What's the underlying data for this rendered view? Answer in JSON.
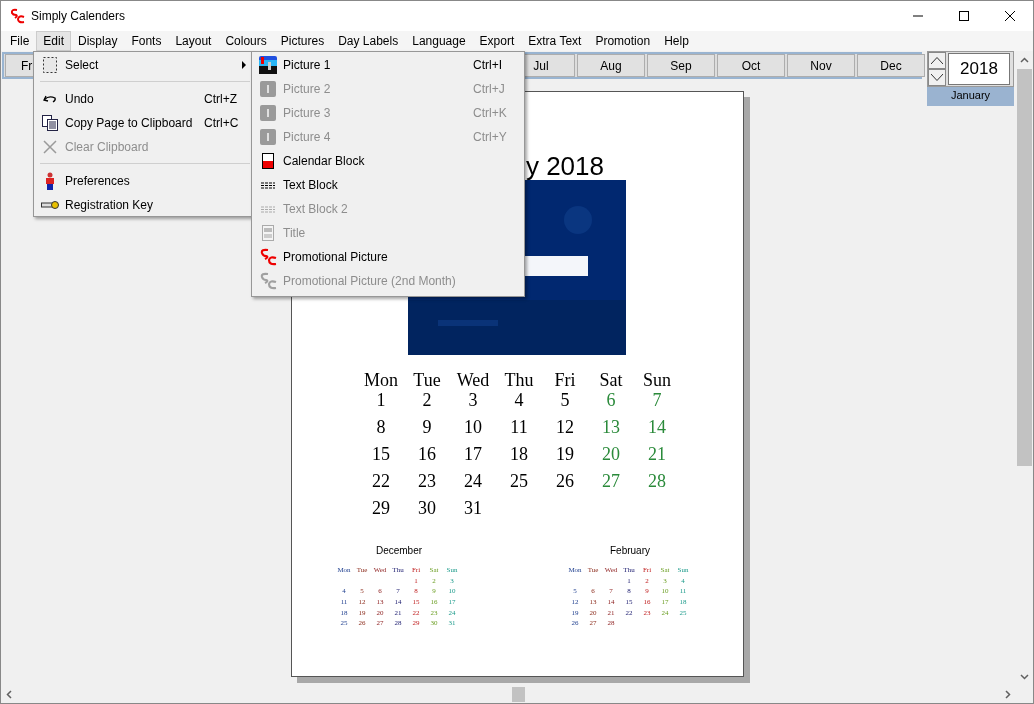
{
  "window": {
    "title": "Simply Calenders"
  },
  "menu_bar": [
    {
      "label": "File",
      "selected": false
    },
    {
      "label": "Edit",
      "selected": true
    },
    {
      "label": "Display",
      "selected": false
    },
    {
      "label": "Fonts",
      "selected": false
    },
    {
      "label": "Layout",
      "selected": false
    },
    {
      "label": "Colours",
      "selected": false
    },
    {
      "label": "Pictures",
      "selected": false
    },
    {
      "label": "Day Labels",
      "selected": false
    },
    {
      "label": "Language",
      "selected": false
    },
    {
      "label": "Export",
      "selected": false
    },
    {
      "label": "Extra Text",
      "selected": false
    },
    {
      "label": "Promotion",
      "selected": false
    },
    {
      "label": "Help",
      "selected": false
    }
  ],
  "month_buttons": [
    {
      "label": "Fr"
    },
    {
      "label": "Jul"
    },
    {
      "label": "Aug"
    },
    {
      "label": "Sep"
    },
    {
      "label": "Oct"
    },
    {
      "label": "Nov"
    },
    {
      "label": "Dec"
    }
  ],
  "year_spinner": {
    "value": "2018"
  },
  "month_label": "January",
  "edit_menu": [
    {
      "kind": "item",
      "label": "Select",
      "has_submenu": true,
      "disabled": false
    },
    {
      "kind": "separator"
    },
    {
      "kind": "item",
      "label": "Undo",
      "shortcut": "Ctrl+Z",
      "disabled": false
    },
    {
      "kind": "item",
      "label": "Copy Page to Clipboard",
      "shortcut": "Ctrl+C",
      "disabled": false
    },
    {
      "kind": "item",
      "label": "Clear Clipboard",
      "disabled": true
    },
    {
      "kind": "separator"
    },
    {
      "kind": "item",
      "label": "Preferences",
      "disabled": false
    },
    {
      "kind": "item",
      "label": "Registration Key",
      "disabled": false
    }
  ],
  "select_submenu": [
    {
      "label": "Picture 1",
      "shortcut": "Ctrl+I",
      "disabled": false
    },
    {
      "label": "Picture 2",
      "shortcut": "Ctrl+J",
      "disabled": true
    },
    {
      "label": "Picture 3",
      "shortcut": "Ctrl+K",
      "disabled": true
    },
    {
      "label": "Picture 4",
      "shortcut": "Ctrl+Y",
      "disabled": true
    },
    {
      "label": "Calendar Block",
      "disabled": false
    },
    {
      "label": "Text Block",
      "disabled": false
    },
    {
      "label": "Text Block 2",
      "disabled": true
    },
    {
      "label": "Title",
      "disabled": true
    },
    {
      "label": "Promotional Picture",
      "disabled": false
    },
    {
      "label": "Promotional Picture (2nd Month)",
      "disabled": true
    }
  ],
  "page": {
    "title": "y 2018",
    "calendar": {
      "weekdays": [
        {
          "label": "Mon",
          "weekend": false
        },
        {
          "label": "Tue",
          "weekend": false
        },
        {
          "label": "Wed",
          "weekend": false
        },
        {
          "label": "Thu",
          "weekend": false
        },
        {
          "label": "Fri",
          "weekend": false
        },
        {
          "label": "Sat",
          "weekend": true
        },
        {
          "label": "Sun",
          "weekend": true
        }
      ],
      "weeks": [
        {
          "mon": "1",
          "tue": "2",
          "wed": "3",
          "thu": "4",
          "fri": "5",
          "sat": "6",
          "sun": "7"
        },
        {
          "mon": "8",
          "tue": "9",
          "wed": "10",
          "thu": "11",
          "fri": "12",
          "sat": "13",
          "sun": "14"
        },
        {
          "mon": "15",
          "tue": "16",
          "wed": "17",
          "thu": "18",
          "fri": "19",
          "sat": "20",
          "sun": "21"
        },
        {
          "mon": "22",
          "tue": "23",
          "wed": "24",
          "thu": "25",
          "fri": "26",
          "sat": "27",
          "sun": "28"
        },
        {
          "mon": "29",
          "tue": "30",
          "wed": "31"
        }
      ]
    },
    "mini_calendars": [
      {
        "title": "December",
        "weekdays": [
          "Mon",
          "Tue",
          "Wed",
          "Thu",
          "Fri",
          "Sat",
          "Sun"
        ],
        "weeks": [
          {
            "fri": "1",
            "sat": "2",
            "sun": "3"
          },
          {
            "mon": "4",
            "tue": "5",
            "wed": "6",
            "thu": "7",
            "fri": "8",
            "sat": "9",
            "sun": "10"
          },
          {
            "mon": "11",
            "tue": "12",
            "wed": "13",
            "thu": "14",
            "fri": "15",
            "sat": "16",
            "sun": "17"
          },
          {
            "mon": "18",
            "tue": "19",
            "wed": "20",
            "thu": "21",
            "fri": "22",
            "sat": "23",
            "sun": "24"
          },
          {
            "mon": "25",
            "tue": "26",
            "wed": "27",
            "thu": "28",
            "fri": "29",
            "sat": "30",
            "sun": "31"
          }
        ]
      },
      {
        "title": "February",
        "weekdays": [
          "Mon",
          "Tue",
          "Wed",
          "Thu",
          "Fri",
          "Sat",
          "Sun"
        ],
        "weeks": [
          {
            "thu": "1",
            "fri": "2",
            "sat": "3",
            "sun": "4"
          },
          {
            "mon": "5",
            "tue": "6",
            "wed": "7",
            "thu": "8",
            "fri": "9",
            "sat": "10",
            "sun": "11"
          },
          {
            "mon": "12",
            "tue": "13",
            "wed": "14",
            "thu": "15",
            "fri": "16",
            "sat": "17",
            "sun": "18"
          },
          {
            "mon": "19",
            "tue": "20",
            "wed": "21",
            "thu": "22",
            "fri": "23",
            "sat": "24",
            "sun": "25"
          },
          {
            "mon": "26",
            "tue": "27",
            "wed": "28"
          }
        ]
      }
    ]
  }
}
